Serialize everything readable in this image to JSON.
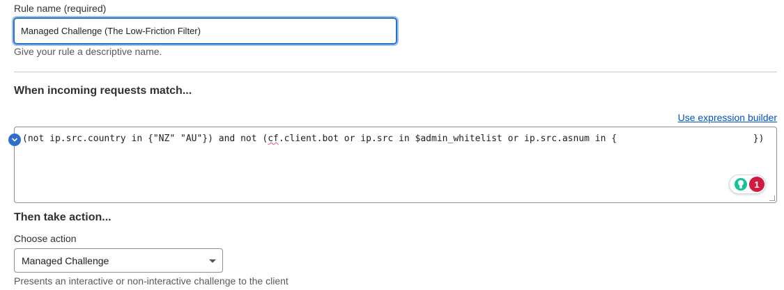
{
  "rule_name": {
    "label": "Rule name (required)",
    "value": "Managed Challenge (The Low-Friction Filter)",
    "helper": "Give your rule a descriptive name."
  },
  "when": {
    "heading": "When incoming requests match...",
    "expression_builder_link": "Use expression builder",
    "expression_before": "(not ip.src.country in {\"NZ\" \"AU\"}) and not (",
    "expression_flagged": "cf",
    "expression_after": ".client.bot or ip.src in $admin_whitelist or ip.src.asnum in {                         })",
    "collapse_icon": "chevron-down-icon",
    "grammar_widget": {
      "icon": "lightbulb-icon",
      "count": "1"
    }
  },
  "then": {
    "heading": "Then take action...",
    "choose_label": "Choose action",
    "selected_action": "Managed Challenge",
    "helper": "Presents an interactive or non-interactive challenge to the client"
  },
  "colors": {
    "focus_border": "#2472c8",
    "link": "#0051c3",
    "badge": "#d11a3d",
    "grammar_green": "#15c39a"
  }
}
